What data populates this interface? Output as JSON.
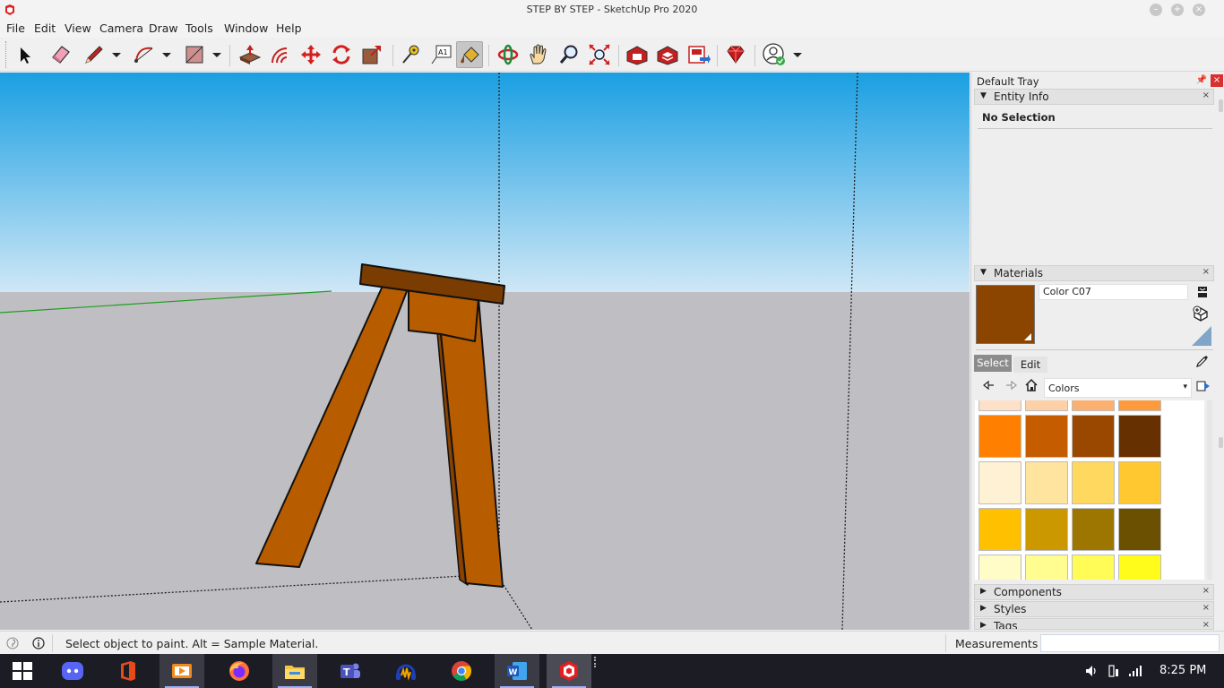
{
  "window": {
    "title": "STEP BY STEP - SketchUp Pro 2020"
  },
  "menu": [
    "File",
    "Edit",
    "View",
    "Camera",
    "Draw",
    "Tools",
    "Window",
    "Help"
  ],
  "toolbar": {
    "tools": [
      {
        "name": "select-tool",
        "icon": "arrow-cursor-icon"
      },
      {
        "name": "eraser-tool",
        "icon": "eraser-icon"
      },
      {
        "name": "line-tool",
        "icon": "pencil-icon"
      },
      {
        "name": "arc-tool",
        "icon": "arc-icon"
      },
      {
        "name": "rectangle-tool",
        "icon": "rectangle-icon"
      },
      {
        "name": "push-pull-tool",
        "icon": "push-pull-icon"
      },
      {
        "name": "offset-tool",
        "icon": "offset-icon"
      },
      {
        "name": "move-tool",
        "icon": "move-icon"
      },
      {
        "name": "rotate-tool",
        "icon": "rotate-icon"
      },
      {
        "name": "scale-tool",
        "icon": "scale-icon"
      },
      {
        "name": "tape-measure-tool",
        "icon": "tape-measure-icon"
      },
      {
        "name": "text-tool",
        "icon": "text-label-icon"
      },
      {
        "name": "paint-bucket-tool",
        "icon": "paint-bucket-icon"
      },
      {
        "name": "orbit-tool",
        "icon": "orbit-icon"
      },
      {
        "name": "pan-tool",
        "icon": "hand-icon"
      },
      {
        "name": "zoom-tool",
        "icon": "magnifier-icon"
      },
      {
        "name": "zoom-extents-tool",
        "icon": "zoom-extents-icon"
      },
      {
        "name": "3d-warehouse-button",
        "icon": "warehouse-icon"
      },
      {
        "name": "extension-warehouse-button",
        "icon": "extension-warehouse-icon"
      },
      {
        "name": "layout-button",
        "icon": "layout-icon"
      },
      {
        "name": "extension-manager-button",
        "icon": "ruby-gem-icon"
      },
      {
        "name": "account-button",
        "icon": "user-account-icon"
      }
    ],
    "text_tool_label": "A1"
  },
  "tray": {
    "title": "Default Tray",
    "entity_info": {
      "label": "Entity Info",
      "value": "No Selection"
    },
    "materials": {
      "label": "Materials",
      "current_name": "Color C07",
      "current_color": "#8b4500",
      "tabs": [
        "Select",
        "Edit"
      ],
      "library": "Colors",
      "swatches": [
        [
          "#fde0c8",
          "#fdd0a8",
          "#fcb070",
          "#fc9a3c"
        ],
        [
          "#ff8000",
          "#c65c00",
          "#9a4800",
          "#663000"
        ],
        [
          "#fff2d4",
          "#ffe4a0",
          "#ffd860",
          "#ffc830"
        ],
        [
          "#ffc000",
          "#cc9800",
          "#9c7600",
          "#6a5000"
        ],
        [
          "#fffcc8",
          "#fffc90",
          "#fffc58",
          "#fffc1c"
        ]
      ]
    },
    "collapsed_panels": [
      "Components",
      "Styles",
      "Tags"
    ]
  },
  "status": {
    "hint": "Select object to paint. Alt = Sample Material.",
    "measurements_label": "Measurements",
    "measurements_value": ""
  },
  "taskbar": {
    "apps": [
      {
        "name": "discord",
        "icon": "discord-icon"
      },
      {
        "name": "office",
        "icon": "office-icon"
      },
      {
        "name": "media-player",
        "icon": "media-player-icon"
      },
      {
        "name": "firefox",
        "icon": "firefox-icon"
      },
      {
        "name": "file-explorer",
        "icon": "folder-icon"
      },
      {
        "name": "teams",
        "icon": "teams-icon"
      },
      {
        "name": "audacity",
        "icon": "headphones-icon"
      },
      {
        "name": "chrome",
        "icon": "chrome-icon"
      },
      {
        "name": "word",
        "icon": "word-icon"
      },
      {
        "name": "sketchup",
        "icon": "sketchup-icon"
      }
    ],
    "clock": "8:25 PM"
  },
  "colors": {
    "sky_top": "#1a9fe2",
    "sky_horizon": "#cfe7f6",
    "ground": "#bfbfc3",
    "wood": "#b85c00",
    "wood_dark": "#7a3c00",
    "axis_green": "#1f9e1f"
  }
}
